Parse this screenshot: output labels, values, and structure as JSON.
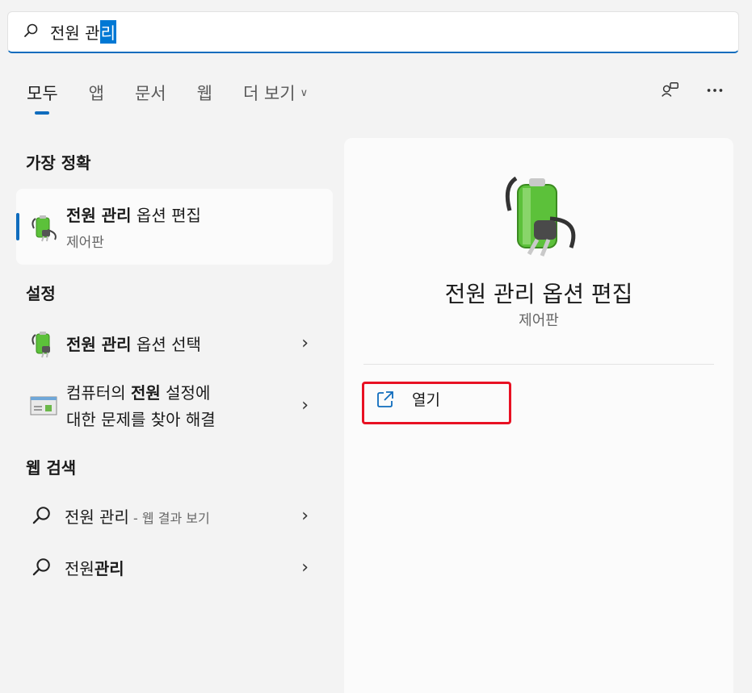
{
  "search": {
    "query_unselected": "전원 관",
    "query_selected": "리"
  },
  "tabs": [
    {
      "label": "모두",
      "active": true
    },
    {
      "label": "앱"
    },
    {
      "label": "문서"
    },
    {
      "label": "웹"
    },
    {
      "label": "더 보기"
    }
  ],
  "sections": {
    "best_match": "가장 정확",
    "settings": "설정",
    "web_search": "웹 검색"
  },
  "best_match_item": {
    "title_bold": "전원 관리",
    "title_rest": " 옵션 편집",
    "subtitle": "제어판"
  },
  "settings_items": [
    {
      "bold": "전원 관리",
      "rest": " 옵션 선택"
    },
    {
      "pre": "컴퓨터의 ",
      "bold": "전원",
      "post": " 설정에",
      "line2": "대한 문제를 찾아 해결"
    }
  ],
  "web_items": [
    {
      "main": "전원 관리",
      "suffix": " - 웹 결과 보기"
    },
    {
      "pre": "전원",
      "bold": "관리"
    }
  ],
  "details": {
    "title": "전원 관리 옵션 편집",
    "subtitle": "제어판",
    "action_open": "열기"
  },
  "colors": {
    "accent": "#0f6cbd",
    "highlight": "#e81123"
  }
}
